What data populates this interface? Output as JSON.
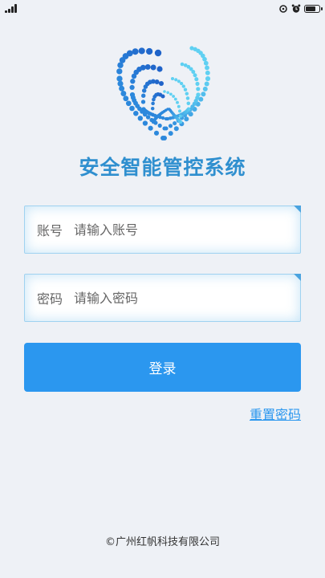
{
  "status_bar": {
    "icons": [
      "signal-icon",
      "sync-icon",
      "alarm-icon",
      "battery-icon"
    ],
    "battery_level": 0.8
  },
  "app": {
    "title": "安全智能管控系统",
    "logo_colors": {
      "dark": "#1f63c9",
      "mid": "#2c88dc",
      "light": "#5fd0f2"
    }
  },
  "form": {
    "account_label": "账号",
    "account_placeholder": "请输入账号",
    "password_label": "密码",
    "password_placeholder": "请输入密码",
    "login_label": "登录",
    "reset_label": "重置密码"
  },
  "footer": {
    "copyright": "©广州红帆科技有限公司"
  },
  "colors": {
    "accent": "#2b97ef",
    "title": "#2f8fcf",
    "background": "#eef1f6"
  }
}
